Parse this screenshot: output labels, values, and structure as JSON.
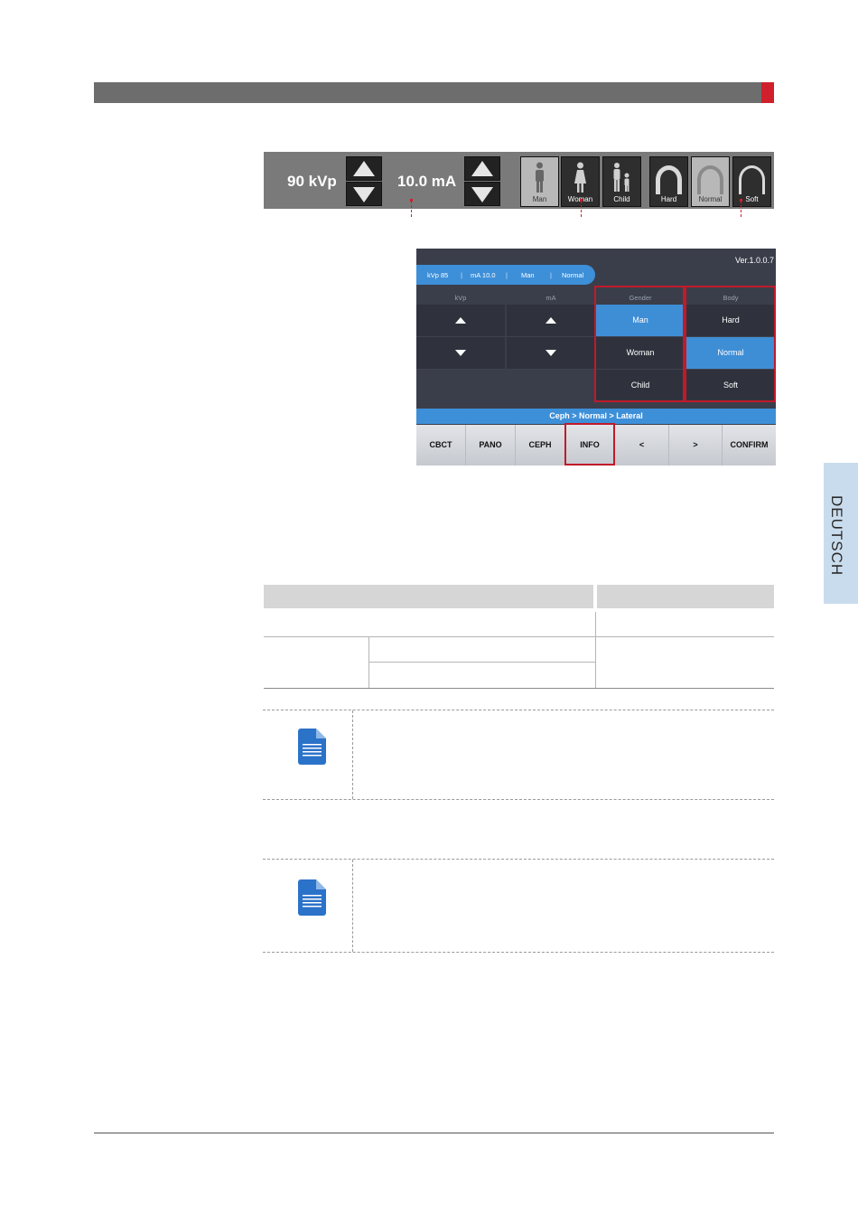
{
  "toolbar": {
    "kvp_value": "90 kVp",
    "ma_value": "10.0 mA",
    "buttons": [
      {
        "label": "Man",
        "icon": "man-icon",
        "active": true
      },
      {
        "label": "Woman",
        "icon": "woman-icon",
        "active": false
      },
      {
        "label": "Child",
        "icon": "child-icon",
        "active": false
      },
      {
        "label": "Hard",
        "icon": "arch-hard-icon",
        "active": false
      },
      {
        "label": "Normal",
        "icon": "arch-normal-icon",
        "active": true
      },
      {
        "label": "Soft",
        "icon": "arch-soft-icon",
        "active": false
      }
    ]
  },
  "screen": {
    "version": "Ver.1.0.0.7",
    "status": {
      "kvp": "kVp 85",
      "ma": "mA 10.0",
      "gender": "Man",
      "body": "Normal"
    },
    "columns": {
      "kvp": "kVp",
      "ma": "mA",
      "gender": "Gender",
      "body": "Body"
    },
    "gender_options": [
      "Man",
      "Woman",
      "Child"
    ],
    "body_options": [
      "Hard",
      "Normal",
      "Soft"
    ],
    "selected_gender": "Man",
    "selected_body": "Normal",
    "breadcrumb": "Ceph > Normal > Lateral",
    "nav": [
      "CBCT",
      "PANO",
      "CEPH",
      "INFO",
      "<",
      ">",
      "CONFIRM"
    ]
  },
  "side_tab": "DEUTSCH",
  "colors": {
    "accent_red": "#d0202b",
    "screen_blue": "#3d8fd8",
    "note_blue": "#2b72c9"
  }
}
